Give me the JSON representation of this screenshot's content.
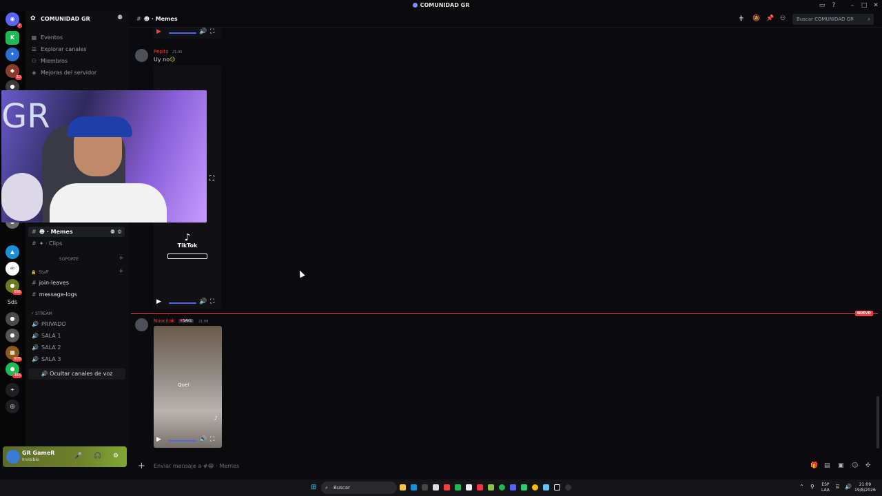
{
  "window": {
    "title": "COMUNIDAD GR"
  },
  "server": {
    "name": "COMUNIDAD GR"
  },
  "sidebar": {
    "top_items": [
      {
        "label": "Eventos",
        "icon": "calendar-icon"
      },
      {
        "label": "Explorar canales",
        "icon": "list-icon"
      },
      {
        "label": "Miembros",
        "icon": "members-icon"
      },
      {
        "label": "Mejoras del servidor",
        "icon": "boost-icon"
      }
    ],
    "channels": [
      {
        "label": "· Memes",
        "emoji": "😂",
        "active": true
      },
      {
        "label": "· Clips",
        "emoji": "🎬",
        "active": false
      }
    ],
    "category_soporte": "SOPORTE",
    "category_staff": "· Staff",
    "staff_channels": [
      {
        "label": "join-leaves"
      },
      {
        "label": "message-logs"
      }
    ],
    "category_stream": "STREAM",
    "voice_channels": [
      {
        "label": "PRIVADO"
      },
      {
        "label": "SALA 1"
      },
      {
        "label": "SALA 2"
      },
      {
        "label": "SALA 3"
      }
    ],
    "hide_voice_label": "Ocultar canales de voz"
  },
  "guild_badges": {
    "g1": "7",
    "g2": "10",
    "g3": "686",
    "g4": "605",
    "g5": "383",
    "text_server": "Sds"
  },
  "user": {
    "name": "GR GameR",
    "status": "Invisible"
  },
  "header": {
    "channel_name": "· Memes",
    "search_placeholder": "Buscar COMUNIDAD GR"
  },
  "messages": [
    {
      "author": "Pepito",
      "time": "21:05",
      "text": "Uy no",
      "video_label": "TikTok"
    },
    {
      "author": "Noocitak",
      "tag": "SAKU",
      "time": "21:08",
      "video_caption": "Que!"
    }
  ],
  "new_badge": "NUEVO",
  "composer": {
    "placeholder": "Enviar mensaje a #😂 · Memes"
  },
  "taskbar": {
    "search_label": "Buscar",
    "lang": "ESP",
    "lang2": "LAA",
    "time": "21:09",
    "date": "19/8/2026"
  },
  "colors": {
    "accent": "#5865f2",
    "mention_red": "#f23f43",
    "user_panel": "#6f7f2b"
  }
}
